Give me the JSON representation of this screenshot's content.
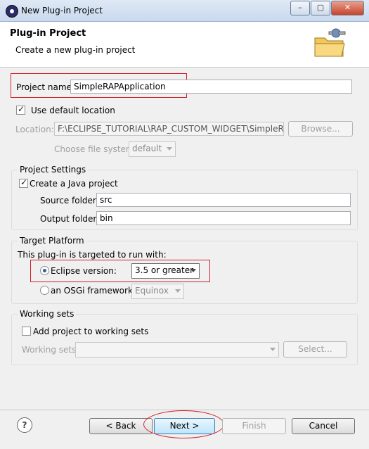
{
  "window": {
    "title": "New Plug-in Project",
    "minimize": "–",
    "restore": "▢",
    "close": "✕"
  },
  "header": {
    "title": "Plug-in Project",
    "subtitle": "Create a new plug-in project"
  },
  "project": {
    "name_label": "Project name:",
    "name_value": "SimpleRAPApplication",
    "use_default_location_label": "Use default location",
    "use_default_location_checked": true,
    "location_label": "Location:",
    "location_value": "F:\\ECLIPSE_TUTORIAL\\RAP_CUSTOM_WIDGET\\SimpleRAPA",
    "browse_label": "Browse...",
    "file_system_label": "Choose file system:",
    "file_system_value": "default"
  },
  "project_settings": {
    "title": "Project Settings",
    "create_java_label": "Create a Java project",
    "create_java_checked": true,
    "source_folder_label": "Source folder:",
    "source_folder_value": "src",
    "output_folder_label": "Output folder:",
    "output_folder_value": "bin"
  },
  "target_platform": {
    "title": "Target Platform",
    "intro": "This plug-in is targeted to run with:",
    "eclipse_version_label": "Eclipse version:",
    "eclipse_version_value": "3.5 or greater",
    "osgi_label": "an OSGi framework:",
    "osgi_value": "Equinox"
  },
  "working_sets": {
    "title": "Working sets",
    "add_label": "Add project to working sets",
    "add_checked": false,
    "sets_label": "Working sets:",
    "select_label": "Select..."
  },
  "footer": {
    "help": "?",
    "back": "< Back",
    "next": "Next >",
    "finish": "Finish",
    "cancel": "Cancel"
  }
}
